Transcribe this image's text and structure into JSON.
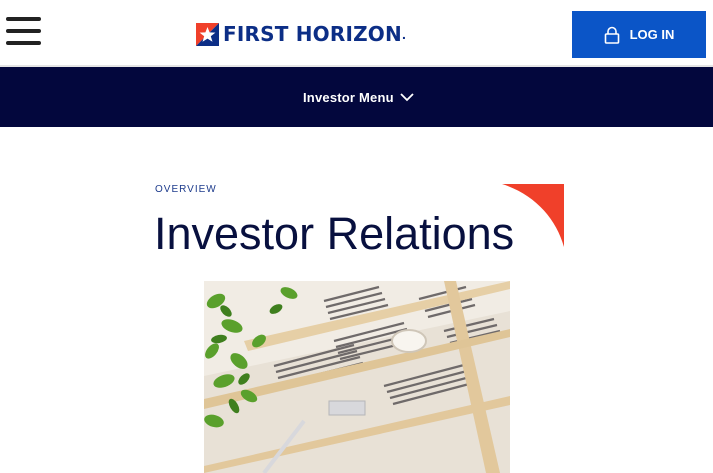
{
  "header": {
    "logo_text": "FIRST HORIZON",
    "login_label": "LOG IN"
  },
  "nav": {
    "investor_menu_label": "Investor Menu"
  },
  "page": {
    "eyebrow": "OVERVIEW",
    "title": "Investor Relations"
  },
  "colors": {
    "brand_blue": "#0c2e86",
    "login_blue": "#0b55c7",
    "nav_navy": "#03073d",
    "accent_red": "#f0402a"
  },
  "icons": [
    "menu-icon",
    "lock-icon",
    "chevron-down-icon",
    "star-logo-icon"
  ]
}
